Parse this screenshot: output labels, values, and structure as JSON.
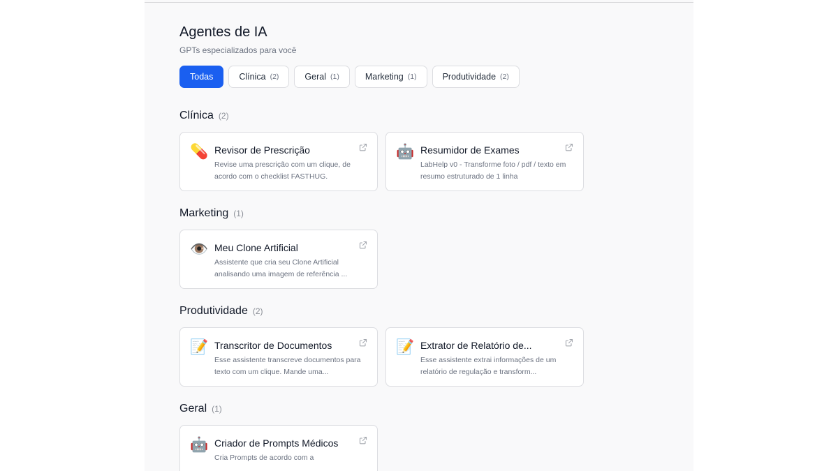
{
  "page": {
    "title": "Agentes de IA",
    "subtitle": "GPTs especializados para você"
  },
  "filters": [
    {
      "label": "Todas",
      "count": "",
      "active": true
    },
    {
      "label": "Clínica",
      "count": "(2)",
      "active": false
    },
    {
      "label": "Geral",
      "count": "(1)",
      "active": false
    },
    {
      "label": "Marketing",
      "count": "(1)",
      "active": false
    },
    {
      "label": "Produtividade",
      "count": "(2)",
      "active": false
    }
  ],
  "sections": [
    {
      "title": "Clínica",
      "count": "(2)",
      "agents": [
        {
          "icon": "pill-icon",
          "emoji": "💊",
          "name": "Revisor de Prescrição",
          "description": "Revise uma prescrição com um clique, de acordo com o checklist FASTHUG."
        },
        {
          "icon": "robot-icon",
          "emoji": "🤖",
          "name": "Resumidor de Exames",
          "description": "LabHelp v0 - Transforme foto / pdf / texto em resumo estruturado de 1 linha"
        }
      ]
    },
    {
      "title": "Marketing",
      "count": "(1)",
      "agents": [
        {
          "icon": "eye-icon",
          "emoji": "👁️",
          "name": "Meu Clone Artificial",
          "description": "Assistente que cria seu Clone Artificial analisando uma imagem de referência ..."
        }
      ]
    },
    {
      "title": "Produtividade",
      "count": "(2)",
      "agents": [
        {
          "icon": "memo-icon",
          "emoji": "📝",
          "name": "Transcritor de Documentos",
          "description": "Esse assistente transcreve documentos para texto com um clique. Mande uma..."
        },
        {
          "icon": "memo-icon",
          "emoji": "📝",
          "name": "Extrator de Relatório de...",
          "description": "Esse assistente extrai informações de um relatório de regulação e transform..."
        }
      ]
    },
    {
      "title": "Geral",
      "count": "(1)",
      "agents": [
        {
          "icon": "robot-icon",
          "emoji": "🤖",
          "name": "Criador de Prompts Médicos",
          "description": "Cria Prompts de acordo com a"
        }
      ]
    }
  ],
  "colors": {
    "accent": "#1a5ff0",
    "border": "#dcdde1",
    "panel_bg": "#f9f9fa",
    "muted_text": "#6b7280"
  }
}
